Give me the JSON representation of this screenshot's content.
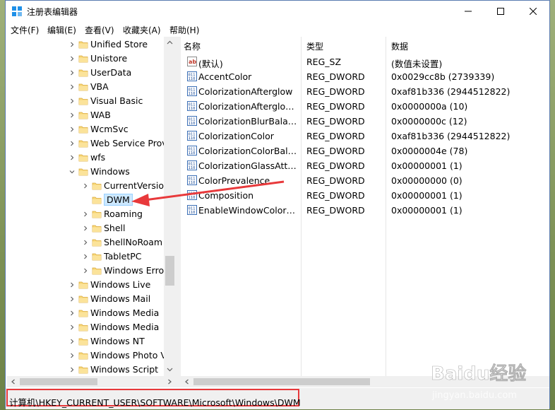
{
  "window": {
    "title": "注册表编辑器",
    "accent": "#0078d7",
    "selection_color": "#cce8ff"
  },
  "menubar": {
    "items": [
      {
        "label": "文件(F)"
      },
      {
        "label": "编辑(E)"
      },
      {
        "label": "查看(V)"
      },
      {
        "label": "收藏夹(A)"
      },
      {
        "label": "帮助(H)"
      }
    ]
  },
  "tree": {
    "items": [
      {
        "label": "Unified Store",
        "expanded": false
      },
      {
        "label": "Unistore",
        "expanded": false
      },
      {
        "label": "UserData",
        "expanded": false
      },
      {
        "label": "VBA",
        "expanded": false
      },
      {
        "label": "Visual Basic",
        "expanded": false
      },
      {
        "label": "WAB",
        "expanded": false
      },
      {
        "label": "WcmSvc",
        "expanded": false
      },
      {
        "label": "Web Service Prov",
        "expanded": false
      },
      {
        "label": "wfs",
        "expanded": false
      },
      {
        "label": "Windows",
        "expanded": true
      },
      {
        "label": "CurrentVersio",
        "expanded": false
      },
      {
        "label": "DWM",
        "selected": true
      },
      {
        "label": "Roaming",
        "expanded": false
      },
      {
        "label": "Shell",
        "expanded": false
      },
      {
        "label": "ShellNoRoam",
        "expanded": false
      },
      {
        "label": "TabletPC",
        "expanded": false
      },
      {
        "label": "Windows Erro",
        "expanded": false
      },
      {
        "label": "Windows Live",
        "expanded": false
      },
      {
        "label": "Windows Mail",
        "expanded": false
      },
      {
        "label": "Windows Media",
        "expanded": false
      },
      {
        "label": "Windows Media",
        "expanded": false
      },
      {
        "label": "Windows NT",
        "expanded": false
      },
      {
        "label": "Windows Photo V",
        "expanded": false
      },
      {
        "label": "Windows Script",
        "expanded": false
      }
    ]
  },
  "list": {
    "columns": [
      "名称",
      "类型",
      "数据"
    ],
    "rows": [
      {
        "name": "(默认)",
        "type": "REG_SZ",
        "data": "(数值未设置)",
        "icon": "string-value-icon"
      },
      {
        "name": "AccentColor",
        "type": "REG_DWORD",
        "data": "0x0029cc8b (2739339)",
        "icon": "binary-value-icon"
      },
      {
        "name": "ColorizationAfterglow",
        "type": "REG_DWORD",
        "data": "0xaf81b336 (2944512822)",
        "icon": "binary-value-icon"
      },
      {
        "name": "ColorizationAfterglow...",
        "type": "REG_DWORD",
        "data": "0x0000000a (10)",
        "icon": "binary-value-icon"
      },
      {
        "name": "ColorizationBlurBalance",
        "type": "REG_DWORD",
        "data": "0x0000000c (12)",
        "icon": "binary-value-icon"
      },
      {
        "name": "ColorizationColor",
        "type": "REG_DWORD",
        "data": "0xaf81b336 (2944512822)",
        "icon": "binary-value-icon"
      },
      {
        "name": "ColorizationColorBala...",
        "type": "REG_DWORD",
        "data": "0x0000004e (78)",
        "icon": "binary-value-icon"
      },
      {
        "name": "ColorizationGlassAttrib...",
        "type": "REG_DWORD",
        "data": "0x00000001 (1)",
        "icon": "binary-value-icon"
      },
      {
        "name": "ColorPrevalence",
        "type": "REG_DWORD",
        "data": "0x00000000 (0)",
        "icon": "binary-value-icon"
      },
      {
        "name": "Composition",
        "type": "REG_DWORD",
        "data": "0x00000001 (1)",
        "icon": "binary-value-icon"
      },
      {
        "name": "EnableWindowColoriz...",
        "type": "REG_DWORD",
        "data": "0x00000001 (1)",
        "icon": "binary-value-icon"
      }
    ]
  },
  "statusbar": {
    "path": "计算机\\HKEY_CURRENT_USER\\SOFTWARE\\Microsoft\\Windows\\DWM",
    "highlight_color": "#e8393b"
  },
  "watermark": {
    "brand": "Baidu经验",
    "url": "jingyan.baidu.com"
  }
}
